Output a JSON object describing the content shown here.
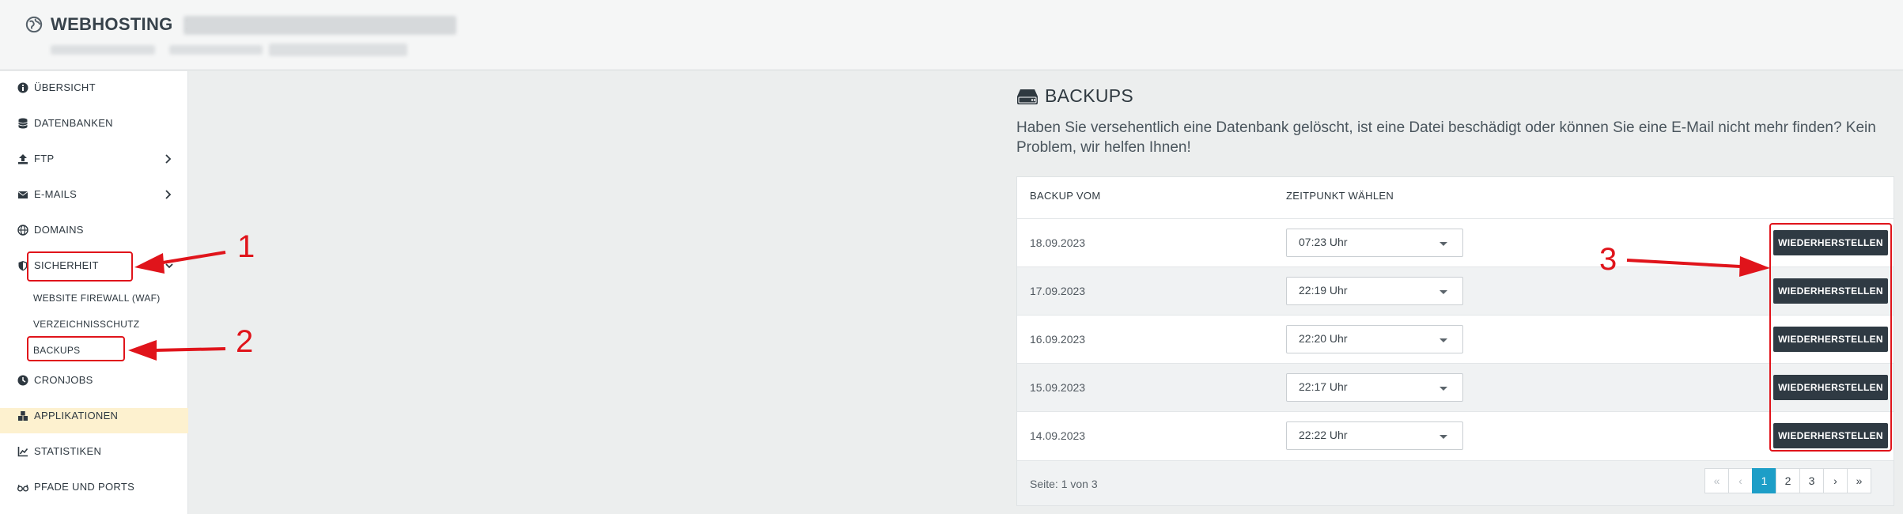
{
  "header": {
    "title": "WEBHOSTING"
  },
  "sidebar": {
    "items": [
      {
        "label": "ÜBERSICHT",
        "icon": "info-circle-icon"
      },
      {
        "label": "DATENBANKEN",
        "icon": "database-icon"
      },
      {
        "label": "FTP",
        "icon": "upload-icon"
      },
      {
        "label": "E-MAILS",
        "icon": "envelope-icon"
      },
      {
        "label": "DOMAINS",
        "icon": "globe-icon"
      },
      {
        "label": "SICHERHEIT",
        "icon": "shield-icon"
      },
      {
        "label": "CRONJOBS",
        "icon": "clock-icon"
      },
      {
        "label": "APPLIKATIONEN",
        "icon": "cubes-icon"
      },
      {
        "label": "STATISTIKEN",
        "icon": "chart-line-icon"
      },
      {
        "label": "PFADE UND PORTS",
        "icon": "glasses-icon"
      }
    ],
    "sub_items": [
      "WEBSITE FIREWALL (WAF)",
      "VERZEICHNISSCHUTZ",
      "BACKUPS"
    ]
  },
  "main": {
    "title": "BACKUPS",
    "description": "Haben Sie versehentlich eine Datenbank gelöscht, ist eine Datei beschädigt oder können Sie eine E-Mail nicht mehr finden? Kein Problem, wir helfen Ihnen!",
    "table": {
      "columns": [
        "BACKUP VOM",
        "ZEITPUNKT WÄHLEN"
      ],
      "rows": [
        {
          "date": "18.09.2023",
          "time": "07:23 Uhr",
          "action": "WIEDERHERSTELLEN"
        },
        {
          "date": "17.09.2023",
          "time": "22:19 Uhr",
          "action": "WIEDERHERSTELLEN"
        },
        {
          "date": "16.09.2023",
          "time": "22:20 Uhr",
          "action": "WIEDERHERSTELLEN"
        },
        {
          "date": "15.09.2023",
          "time": "22:17 Uhr",
          "action": "WIEDERHERSTELLEN"
        },
        {
          "date": "14.09.2023",
          "time": "22:22 Uhr",
          "action": "WIEDERHERSTELLEN"
        }
      ]
    },
    "pagination": {
      "info": "Seite: 1 von 3",
      "first": "«",
      "prev": "‹",
      "pages": [
        "1",
        "2",
        "3"
      ],
      "current": "1",
      "next": "›",
      "last": "»"
    }
  },
  "annotations": {
    "labels": [
      "1",
      "2",
      "3"
    ],
    "color": "#e0141b"
  },
  "colors": {
    "accent": "#1d9ec7",
    "button": "#2f3a43",
    "highlight": "#fdf1cf"
  }
}
